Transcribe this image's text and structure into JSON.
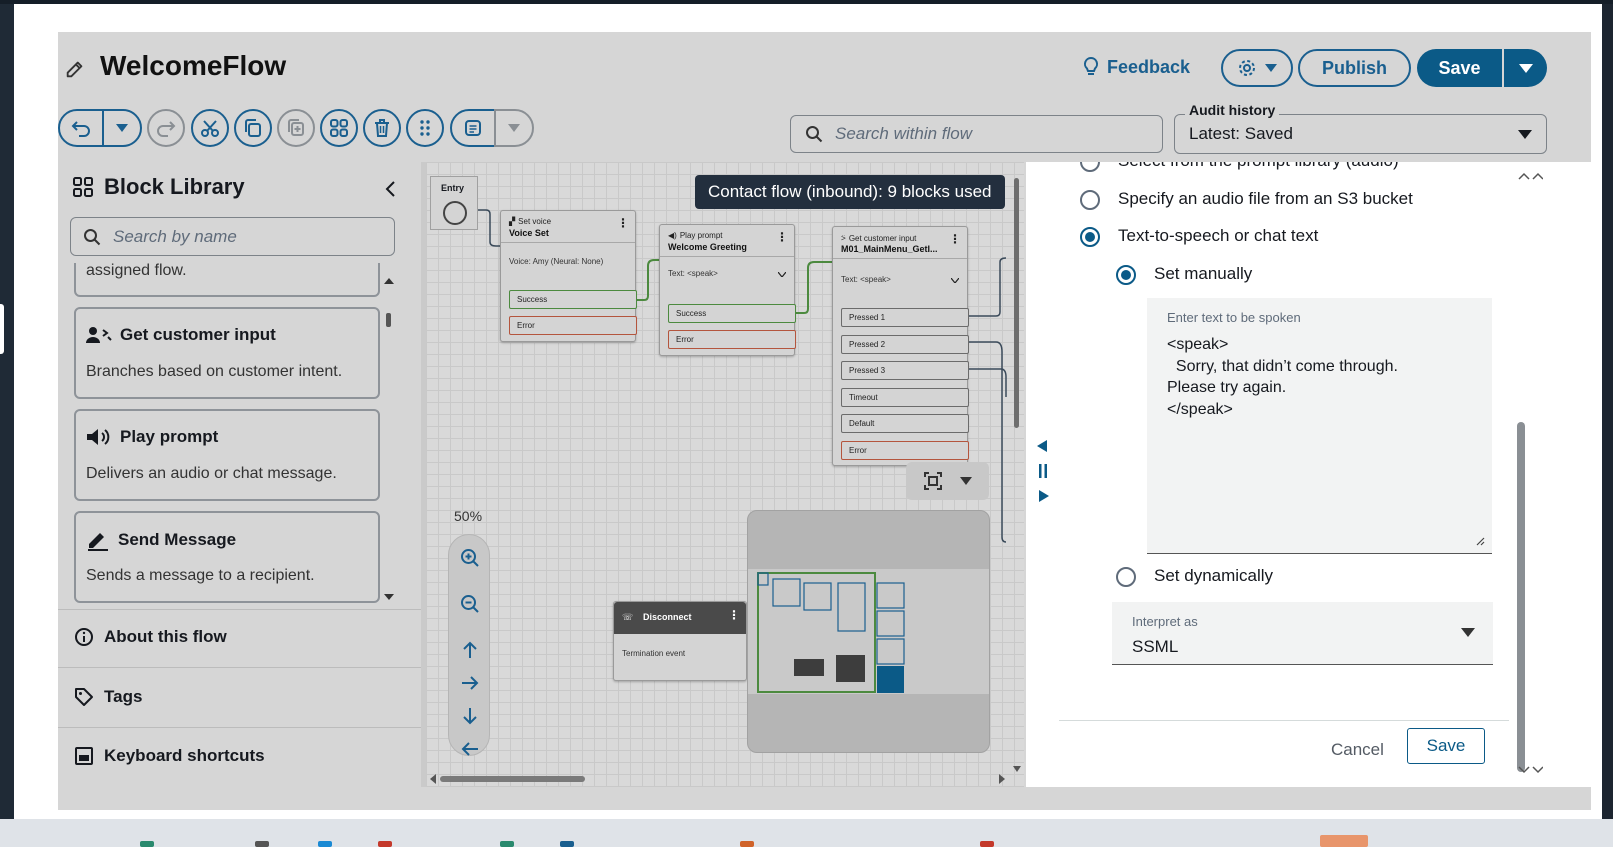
{
  "app": {
    "title": "WelcomeFlow",
    "feedback_label": "Feedback",
    "publish_label": "Publish",
    "save_label": "Save"
  },
  "toolbar": {
    "search_placeholder": "Search within flow",
    "audit_label": "Audit history",
    "audit_value": "Latest: Saved"
  },
  "block_library": {
    "title": "Block Library",
    "search_placeholder": "Search by name",
    "partial_card_text": "assigned flow.",
    "cards": [
      {
        "title": "Get customer input",
        "desc": "Branches based on customer intent.",
        "icon": "user-input-icon"
      },
      {
        "title": "Play prompt",
        "desc": "Delivers an audio or chat message.",
        "icon": "speaker-icon"
      },
      {
        "title": "Send Message",
        "desc": "Sends a message to a recipient.",
        "icon": "pen-icon"
      }
    ],
    "sections": [
      {
        "label": "About this flow",
        "icon": "info-icon"
      },
      {
        "label": "Tags",
        "icon": "tag-icon"
      },
      {
        "label": "Keyboard shortcuts",
        "icon": "keyboard-icon"
      }
    ]
  },
  "canvas": {
    "tooltip": "Contact flow (inbound): 9 blocks used",
    "entry_label": "Entry",
    "zoom_label": "50%",
    "nodes": {
      "set_voice": {
        "type": "Set voice",
        "name": "Voice Set",
        "body": "Voice: Amy (Neural: None)",
        "branches": [
          "Success",
          "Error"
        ]
      },
      "play_prompt": {
        "type": "Play prompt",
        "name": "Welcome Greeting",
        "body": "Text: <speak>",
        "branches": [
          "Success",
          "Error"
        ]
      },
      "get_input": {
        "type": "Get customer input",
        "name": "M01_MainMenu_GetI...",
        "body": "Text: <speak>",
        "branches": [
          "Pressed 1",
          "Pressed 2",
          "Pressed 3",
          "Timeout",
          "Default",
          "Error"
        ]
      },
      "disconnect": {
        "name": "Disconnect",
        "body": "Termination event"
      }
    }
  },
  "properties": {
    "option_prompt_library": "Select from the prompt library (audio)",
    "option_s3": "Specify an audio file from an S3 bucket",
    "option_tts": "Text-to-speech or chat text",
    "set_manually": "Set manually",
    "textarea_label": "Enter text to be spoken",
    "textarea_value": "<speak>\n  Sorry, that didn’t come through.\nPlease try again.\n</speak>",
    "set_dynamically": "Set dynamically",
    "interpret_label": "Interpret as",
    "interpret_value": "SSML",
    "cancel_label": "Cancel",
    "save_label": "Save"
  },
  "colors": {
    "accent": "#0b5a87",
    "success_connector": "#4c8a3f",
    "error_connector": "#b4553d",
    "tooltip_bg": "#232f3e"
  }
}
